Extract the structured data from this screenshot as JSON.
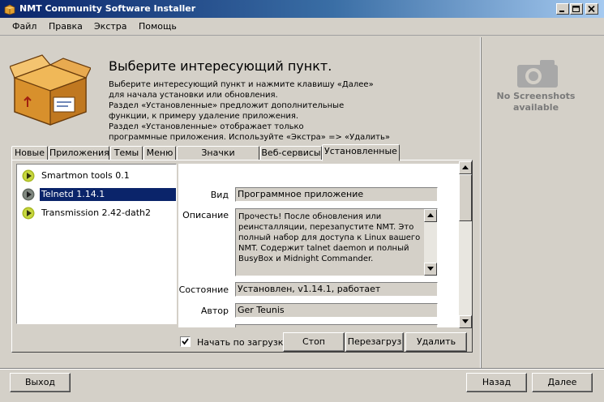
{
  "window": {
    "title": "NMT Community Software Installer",
    "icons": {
      "app": "installer-box-icon",
      "minimize": "minimize-icon",
      "maximize": "maximize-icon",
      "close": "close-icon"
    }
  },
  "menu": {
    "items": [
      "Файл",
      "Правка",
      "Экстра",
      "Помощь"
    ]
  },
  "header": {
    "title": "Выберите интересующий пункт.",
    "description_lines": [
      "Выберите интересующий пункт и нажмите клавишу «Далее»",
      "для начала установки или обновления.",
      "Раздел «Установленные» предложит дополнительные",
      "функции, к примеру удаление приложения.",
      "Раздел «Установленные» отображает только",
      "программные приложения. Используйте «Экстра» => «Удалить»"
    ]
  },
  "screenshot_panel": {
    "line1": "No Screenshots",
    "line2": "available"
  },
  "tabs": [
    "Новые",
    "Приложения",
    "Темы",
    "Меню",
    "Значки ожидания",
    "Веб-сервисы",
    "Установленные"
  ],
  "active_tab": "Установленные",
  "packages": [
    {
      "name": "Smartmon tools 0.1",
      "selected": false
    },
    {
      "name": "Telnetd 1.14.1",
      "selected": true
    },
    {
      "name": "Transmission 2.42-dath2",
      "selected": false
    }
  ],
  "details": {
    "type_label": "Вид",
    "type_value": "Программное приложение",
    "desc_label": "Описание",
    "desc_value": "Прочесть! После обновления или реинсталляции, перезапустите NMT. Это полный набор для доступа к Linux вашего NMT. Содержит talnet daemon и полный BusyBox и Midnight Commander.",
    "state_label": "Состояние",
    "state_value": "Установлен, v1.14.1, работает",
    "author_label": "Автор",
    "author_value": "Ger Teunis"
  },
  "actions": {
    "autostart_label": "Начать по загрузке",
    "autostart_checked": true,
    "stop": "Стоп",
    "restart": "Перезагруз",
    "remove": "Удалить"
  },
  "nav": {
    "exit": "Выход",
    "back": "Назад",
    "next": "Далее"
  }
}
